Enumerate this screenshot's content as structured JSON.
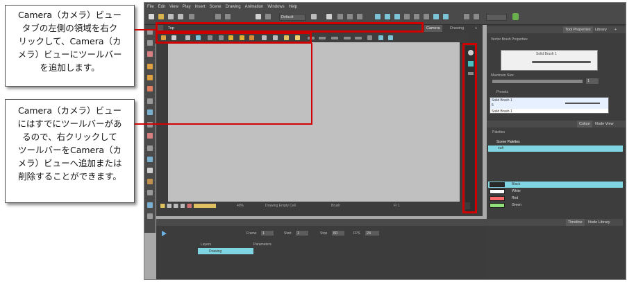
{
  "callouts": {
    "top": {
      "line1": "Camera（カメラ）ビュー",
      "line2": "タブの左側の領域を右ク",
      "line3": "リックして、Camera（カ",
      "line4": "メラ）ビューにツールバー",
      "line5": "を追加します。"
    },
    "bottom": {
      "line1": "Camera（カメラ）ビュー",
      "line2": "にはすでにツールバーがあ",
      "line3": "るので、右クリックして",
      "line4": "ツールバーをCamera（カ",
      "line5": "メラ）ビューへ追加または",
      "line6": "削除することができます。"
    }
  },
  "app": {
    "menu": [
      "File",
      "Edit",
      "View",
      "Play",
      "Insert",
      "Scene",
      "Drawing",
      "Animation",
      "Windows",
      "Help"
    ],
    "toolbar": {
      "preset_select": "Default"
    },
    "camera_view": {
      "breadcrumb": "Top",
      "tabs": [
        "Camera",
        "Drawing"
      ],
      "status": {
        "zoom": "40%",
        "mode": "Drawing Empty Cell",
        "tool": "Brush",
        "frame": "Fr 1"
      }
    },
    "tool_properties": {
      "tabs": [
        "Tool Properties",
        "Library"
      ],
      "title": "Vector Brush Properties",
      "brush_name": "Solid Brush 1",
      "max_size_label": "Maximum Size",
      "max_size_value": "1",
      "presets_label": "Presets",
      "preset_items": [
        {
          "name": "Solid Brush 1",
          "size": "5"
        },
        {
          "name": "Solid Brush 1",
          "size": ""
        }
      ]
    },
    "colour": {
      "tabs": [
        "Colour",
        "Node View"
      ],
      "palettes_label": "Palettes",
      "scene_palettes_label": "Scene Palettes",
      "palette_name": "eufr",
      "swatches": [
        {
          "name": "Black",
          "color": "#2a2a2a"
        },
        {
          "name": "White",
          "color": "#ffffff"
        },
        {
          "name": "Red",
          "color": "#ff6a6a"
        },
        {
          "name": "Green",
          "color": "#8fe07a"
        }
      ]
    },
    "timeline": {
      "tabs": [
        "Timeline",
        "Node Library"
      ],
      "frame_label": "Frame",
      "frame_value": "1",
      "start_label": "Start",
      "start_value": "1",
      "stop_label": "Stop",
      "stop_value": "60",
      "fps_label": "FPS",
      "fps_value": "24",
      "layers_label": "Layers",
      "params_label": "Parameters",
      "layer_name": "Drawing"
    }
  }
}
